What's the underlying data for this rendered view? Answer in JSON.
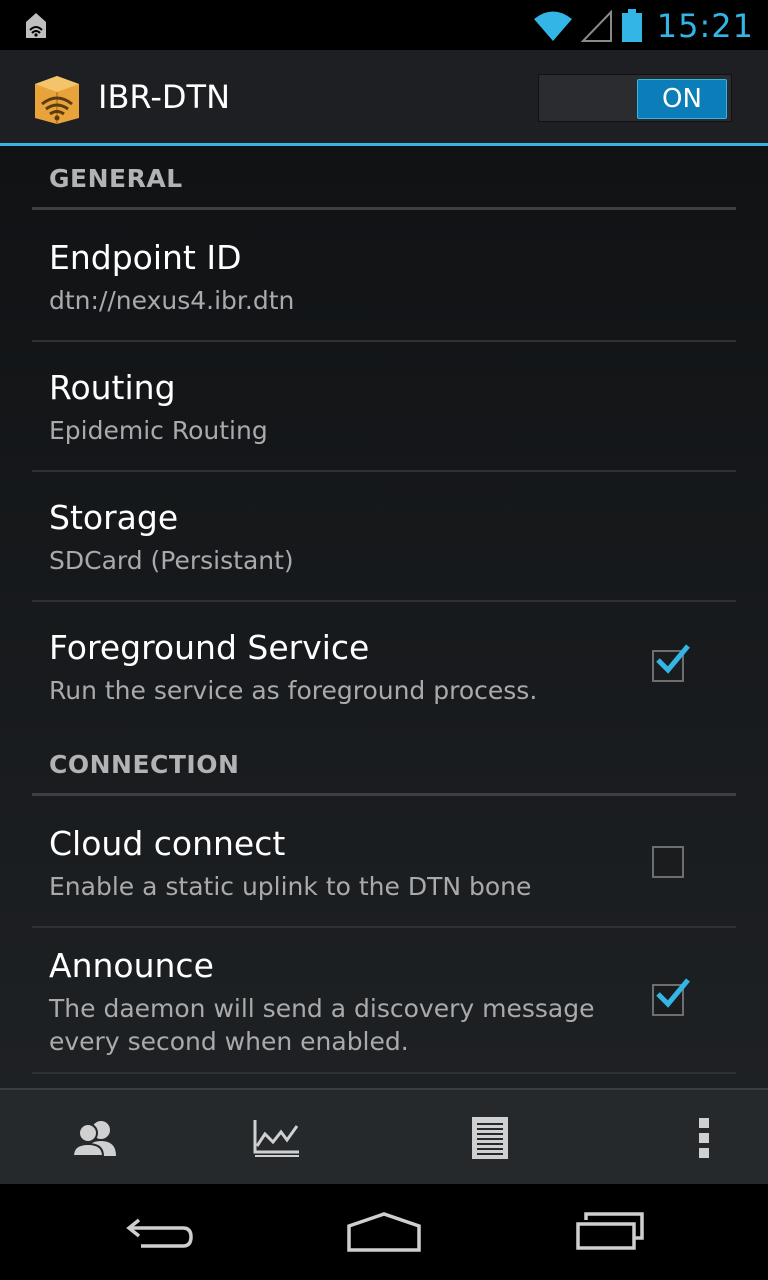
{
  "status_bar": {
    "time": "15:21",
    "icons": [
      "notification-icon",
      "wifi-icon",
      "signal-icon",
      "battery-icon"
    ]
  },
  "action_bar": {
    "title": "IBR-DTN",
    "toggle_label": "ON",
    "toggle_state": "on",
    "accent_color": "#33b5e5"
  },
  "general": {
    "header": "GENERAL",
    "endpoint": {
      "title": "Endpoint ID",
      "summary": "dtn://nexus4.ibr.dtn"
    },
    "routing": {
      "title": "Routing",
      "summary": "Epidemic Routing"
    },
    "storage": {
      "title": "Storage",
      "summary": "SDCard (Persistant)"
    },
    "foreground": {
      "title": "Foreground Service",
      "summary": "Run the service as foreground process.",
      "checked": true
    }
  },
  "connection": {
    "header": "CONNECTION",
    "cloud": {
      "title": "Cloud connect",
      "summary": "Enable a static uplink to the DTN bone",
      "checked": false
    },
    "announce": {
      "title": "Announce",
      "summary_line1": "The daemon will send a discovery message",
      "summary_line2": "every second when enabled.",
      "checked": true
    }
  },
  "bottom_bar": {
    "icons": [
      "neighbors-icon",
      "statistics-icon",
      "log-icon",
      "overflow-menu-icon"
    ]
  },
  "nav_bar": {
    "icons": [
      "back-icon",
      "home-icon",
      "recents-icon"
    ]
  }
}
